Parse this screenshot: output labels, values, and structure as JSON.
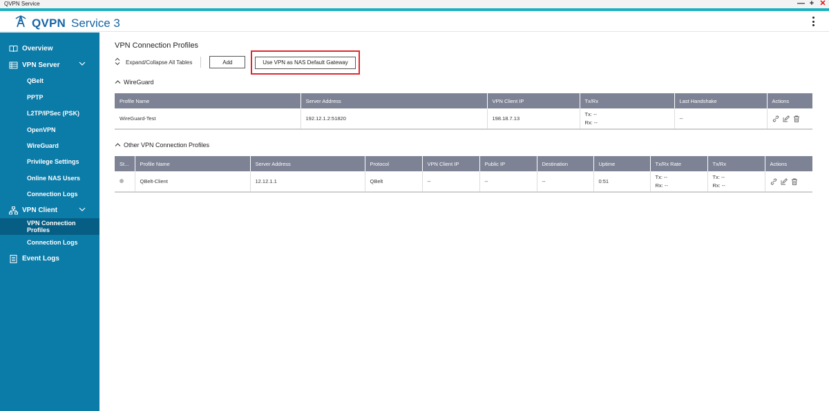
{
  "window": {
    "title": "QVPN Service",
    "controls": {
      "minimize": "—",
      "maximize": "+",
      "close": "✕"
    }
  },
  "header": {
    "brand": "QVPN",
    "product": "Service 3"
  },
  "sidebar": {
    "items": [
      {
        "label": "Overview",
        "icon": "book-icon"
      },
      {
        "label": "VPN Server",
        "icon": "server-icon"
      },
      {
        "label": "QBelt"
      },
      {
        "label": "PPTP"
      },
      {
        "label": "L2TP/IPSec (PSK)"
      },
      {
        "label": "OpenVPN"
      },
      {
        "label": "WireGuard"
      },
      {
        "label": "Privilege Settings"
      },
      {
        "label": "Online NAS Users"
      },
      {
        "label": "Connection Logs"
      },
      {
        "label": "VPN Client",
        "icon": "network-icon"
      },
      {
        "label": "VPN Connection Profiles",
        "active": true
      },
      {
        "label": "Connection Logs"
      },
      {
        "label": "Event Logs",
        "icon": "log-icon"
      }
    ]
  },
  "main": {
    "title": "VPN Connection Profiles",
    "toolbar": {
      "expand_label": "Expand/Collapse All Tables",
      "add_label": "Add",
      "gateway_label": "Use VPN as NAS Default Gateway"
    },
    "wireguard": {
      "title": "WireGuard",
      "columns": [
        "Profile Name",
        "Server Address",
        "VPN Client IP",
        "Tx/Rx",
        "Last Handshake",
        "Actions"
      ],
      "rows": [
        {
          "profile_name": "WireGuard-Test",
          "server_address": "192.12.1.2:51820",
          "vpn_client_ip": "198.18.7.13",
          "tx": "Tx: --",
          "rx": "Rx: --",
          "last_handshake": "--"
        }
      ]
    },
    "other": {
      "title": "Other VPN Connection Profiles",
      "columns": [
        "St...",
        "Profile Name",
        "Server Address",
        "Protocol",
        "VPN Client IP",
        "Public IP",
        "Destination",
        "Uptime",
        "Tx/Rx Rate",
        "Tx/Rx",
        "Actions"
      ],
      "rows": [
        {
          "profile_name": "QBelt-Client",
          "server_address": "12.12.1.1",
          "protocol": "QBelt",
          "vpn_client_ip": "--",
          "public_ip": "--",
          "destination": "--",
          "uptime": "0:51",
          "rate_tx": "Tx: --",
          "rate_rx": "Rx: --",
          "tx": "Tx: --",
          "rx": "Rx: --"
        }
      ]
    }
  },
  "colors": {
    "sidebar_bg": "#0b7ba8",
    "sidebar_active": "#075e84",
    "accent_bar": "#1ab0c2",
    "table_header": "#7d8394",
    "highlight_box": "#e0262d",
    "brand_blue": "#1565a6"
  }
}
